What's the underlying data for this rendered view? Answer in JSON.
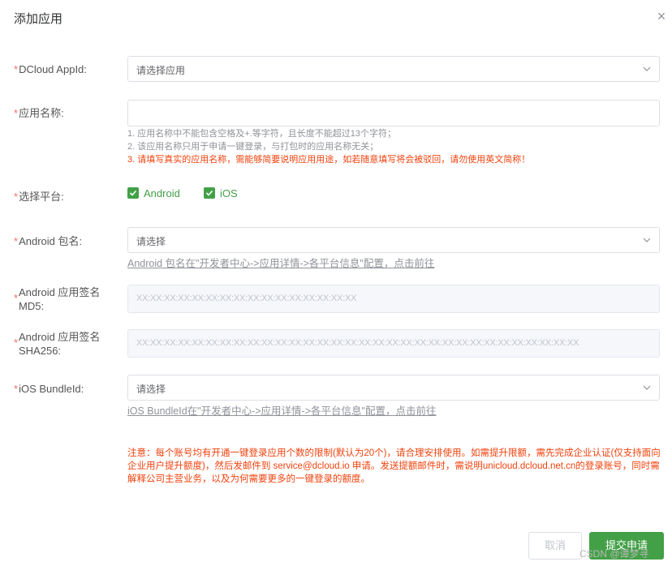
{
  "dialog": {
    "title": "添加应用",
    "close_glyph": "×"
  },
  "form": {
    "appid": {
      "label": "DCloud AppId:",
      "placeholder": "请选择应用"
    },
    "app_name": {
      "label": "应用名称:",
      "value": "",
      "hints": [
        "1. 应用名称中不能包含空格及+.等字符，且长度不能超过13个字符；",
        "2. 该应用名称只用于申请一键登录，与打包时的应用名称无关；"
      ],
      "warning": "3. 请填写真实的应用名称，需能够简要说明应用用途，如若随意填写将会被驳回，请勿使用英文简称！"
    },
    "platform": {
      "label": "选择平台:",
      "options": [
        {
          "label": "Android",
          "checked": true
        },
        {
          "label": "iOS",
          "checked": true
        }
      ]
    },
    "android_package": {
      "label": "Android 包名:",
      "placeholder": "请选择",
      "link": "Android 包名在\"开发者中心->应用详情->各平台信息\"配置，点击前往"
    },
    "android_md5": {
      "label_line1": "Android 应用签名",
      "label_line2": "MD5:",
      "placeholder": "XX:XX:XX:XX:XX:XX:XX:XX:XX:XX:XX:XX:XX:XX:XX:XX"
    },
    "android_sha256": {
      "label_line1": "Android 应用签名",
      "label_line2": "SHA256:",
      "placeholder": "XX:XX:XX:XX:XX:XX:XX:XX:XX:XX:XX:XX:XX:XX:XX:XX:XX:XX:XX:XX:XX:XX:XX:XX:XX:XX:XX:XX:XX:XX:XX:XX"
    },
    "ios_bundleid": {
      "label": "iOS BundleId:",
      "placeholder": "请选择",
      "link": "iOS BundleId在\"开发者中心->应用详情->各平台信息\"配置，点击前往"
    },
    "required_mark": "*"
  },
  "notice": "注意：每个账号均有开通一键登录应用个数的限制(默认为20个)，请合理安排使用。如需提升限额，需先完成企业认证(仅支持面向企业用户提升额度)，然后发邮件到 service@dcloud.io 申请。发送提额邮件时，需说明unicloud.dcloud.net.cn的登录账号，同时需解释公司主营业务，以及为何需要更多的一键登录的额度。",
  "buttons": {
    "cancel": "取消",
    "submit": "提交申请"
  },
  "watermark": "CSDN @谭梦寻",
  "colors": {
    "accent": "#43a047",
    "warning": "#f0420d",
    "required": "#f56c6c"
  }
}
